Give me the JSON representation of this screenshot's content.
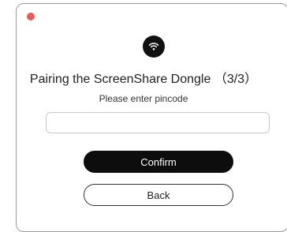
{
  "dialog": {
    "title": "Pairing the ScreenShare Dongle （3/3）",
    "subtitle": "Please enter pincode",
    "pin_input": {
      "value": "",
      "placeholder": ""
    },
    "confirm_label": "Confirm",
    "back_label": "Back",
    "icon": "wifi-icon"
  },
  "colors": {
    "close_dot": "#e95a5a",
    "primary_button": "#0d0d0d",
    "icon_badge": "#111111"
  }
}
